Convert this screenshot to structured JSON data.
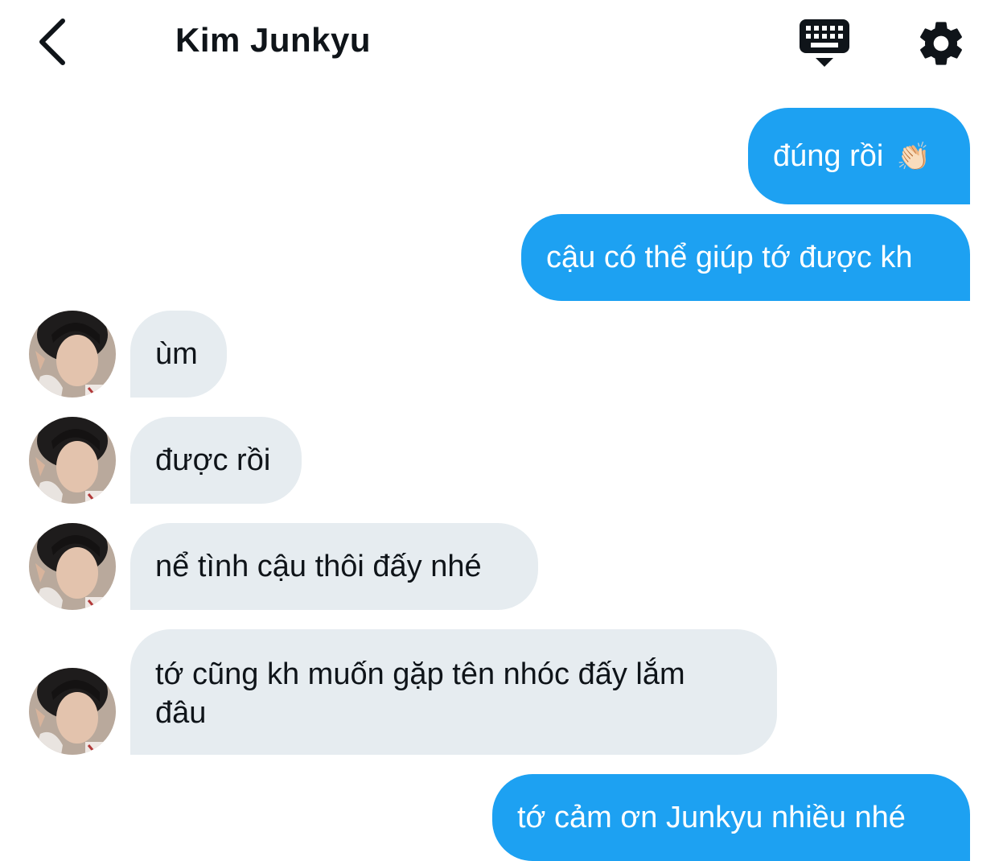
{
  "header": {
    "title": "Kim Junkyu"
  },
  "icons": {
    "back": "chevron-left-icon",
    "keyboard": "keyboard-icon",
    "settings": "gear-icon",
    "clap": "clapping-hands-icon"
  },
  "colors": {
    "outgoing_bubble": "#1da1f2",
    "incoming_bubble": "#e6ecf0",
    "text_dark": "#0f1419"
  },
  "messages": [
    {
      "direction": "out",
      "text": "đúng rồi",
      "emoji": "👏🏻"
    },
    {
      "direction": "out",
      "text": "cậu có thể giúp tớ được kh"
    },
    {
      "direction": "in",
      "text": "ùm"
    },
    {
      "direction": "in",
      "text": "được rồi"
    },
    {
      "direction": "in",
      "text": "nể tình cậu thôi đấy nhé"
    },
    {
      "direction": "in",
      "text": "tớ cũng kh muốn gặp tên nhóc đấy lắm đâu"
    },
    {
      "direction": "out",
      "text": "tớ cảm ơn Junkyu nhiều nhé"
    }
  ]
}
